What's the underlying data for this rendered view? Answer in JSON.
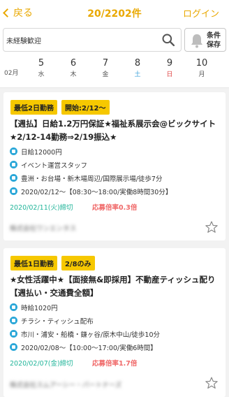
{
  "header": {
    "back_label": "戻る",
    "count": "20/2202件",
    "login_label": "ログイン"
  },
  "search": {
    "value": "未経験歓迎",
    "condition_label_1": "条件",
    "condition_label_2": "保存"
  },
  "calendar": {
    "month": "02月",
    "days": [
      {
        "num": "5",
        "wd": "水"
      },
      {
        "num": "6",
        "wd": "木"
      },
      {
        "num": "7",
        "wd": "金"
      },
      {
        "num": "8",
        "wd": "土"
      },
      {
        "num": "9",
        "wd": "日"
      },
      {
        "num": "10",
        "wd": "月"
      }
    ]
  },
  "jobs": [
    {
      "tags": [
        "最低2日勤務",
        "開始:2/12〜"
      ],
      "title": "【週払】日給1.2万円保証★福祉系展示会@ビックサイト★2/12-14勤務⇒2/19振込★",
      "pay": "日給12000円",
      "category": "イベント運営スタッフ",
      "location": "豊洲・お台場・新木場周辺/国際展示場/徒歩7分",
      "schedule": "2020/02/12〜【08:30〜18:00/実働8時間30分】",
      "deadline": "2020/02/11(火)締切",
      "rate": "応募倍率0.3倍",
      "company": "株式会社ワンエンタス"
    },
    {
      "tags": [
        "最低1日勤務",
        "2/8のみ"
      ],
      "title": "★女性活躍中★【面接無&即採用】不動産ティッシュ配り【週払い・交通費全額】",
      "pay": "時給1020円",
      "category": "チラシ・ティッシュ配布",
      "location": "市川・浦安・船橋・鎌ヶ谷/原木中山/徒歩10分",
      "schedule": "2020/02/08〜【10:00〜17:00/実働6時間】",
      "deadline": "2020/02/07(金)締切",
      "rate": "応募倍率1.7倍",
      "company": "株式会社スムアーシー・パートナーズ"
    }
  ],
  "colors": {
    "accent": "#e9a800",
    "tag": "#f6c800",
    "info_icon": "#2aa7d8",
    "deadline": "#22b59a",
    "rate": "#f06a6a"
  }
}
